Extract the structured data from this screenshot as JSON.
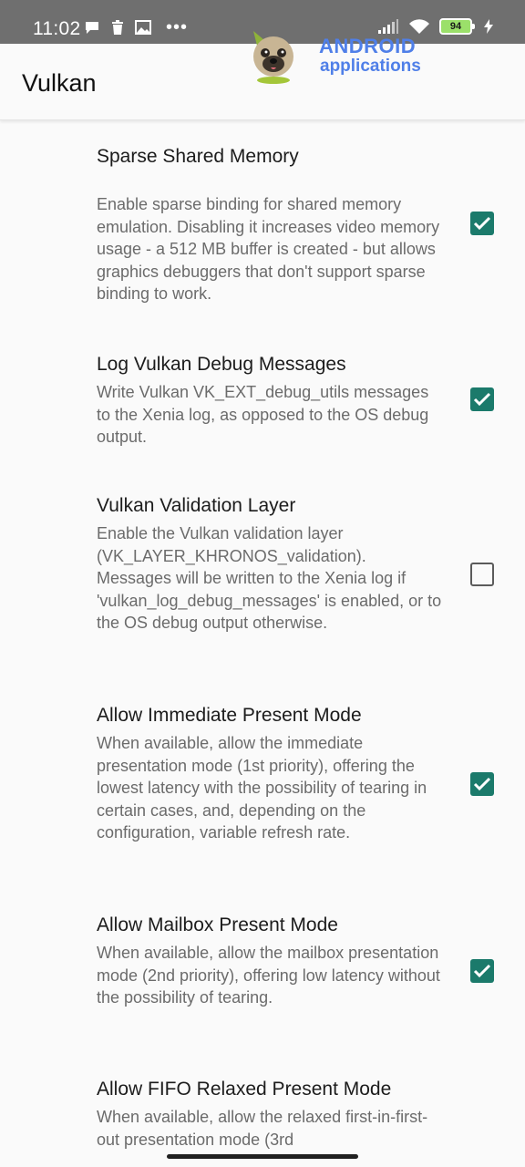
{
  "status_bar": {
    "time": "11:02",
    "battery_level": "94",
    "icons": [
      "chat-bubble-icon",
      "trash-icon",
      "gallery-icon",
      "more-dots-icon",
      "signal-icon",
      "wifi-icon",
      "battery-icon",
      "charging-icon"
    ],
    "dots": "•••"
  },
  "app_bar": {
    "title": "Vulkan"
  },
  "watermark_logo": {
    "line1": "ANDROID",
    "line2": "applications"
  },
  "settings": [
    {
      "title": "Sparse Shared Memory",
      "description": "Enable sparse binding for shared memory emulation. Disabling it increases video memory usage - a 512 MB buffer is created - but allows graphics debuggers that don't support sparse binding to work.",
      "checked": true
    },
    {
      "title": "Log Vulkan Debug Messages",
      "description": "Write Vulkan VK_EXT_debug_utils messages to the Xenia log, as opposed to the OS debug output.",
      "checked": true
    },
    {
      "title": "Vulkan Validation Layer",
      "description": "Enable the Vulkan validation layer (VK_LAYER_KHRONOS_validation). Messages will be written to the Xenia log if 'vulkan_log_debug_messages' is enabled, or to the OS debug output otherwise.",
      "checked": false
    },
    {
      "title": "Allow Immediate Present Mode",
      "description": "When available, allow the immediate presentation mode (1st priority), offering the lowest latency with the possibility of tearing in certain cases, and, depending on the configuration, variable refresh rate.",
      "checked": true
    },
    {
      "title": "Allow Mailbox Present Mode",
      "description": "When available, allow the mailbox presentation mode (2nd priority), offering low latency without the possibility of tearing.",
      "checked": true
    },
    {
      "title": "Allow FIFO Relaxed Present Mode",
      "description": "When available, allow the relaxed first-in-first-out presentation mode (3rd",
      "checked": false
    }
  ],
  "colors": {
    "status_bar_bg": "#6f6f6f",
    "checkbox_checked": "#1b7a6b",
    "logo_blue": "#4f7fe8",
    "battery_fill": "#9be06a"
  }
}
